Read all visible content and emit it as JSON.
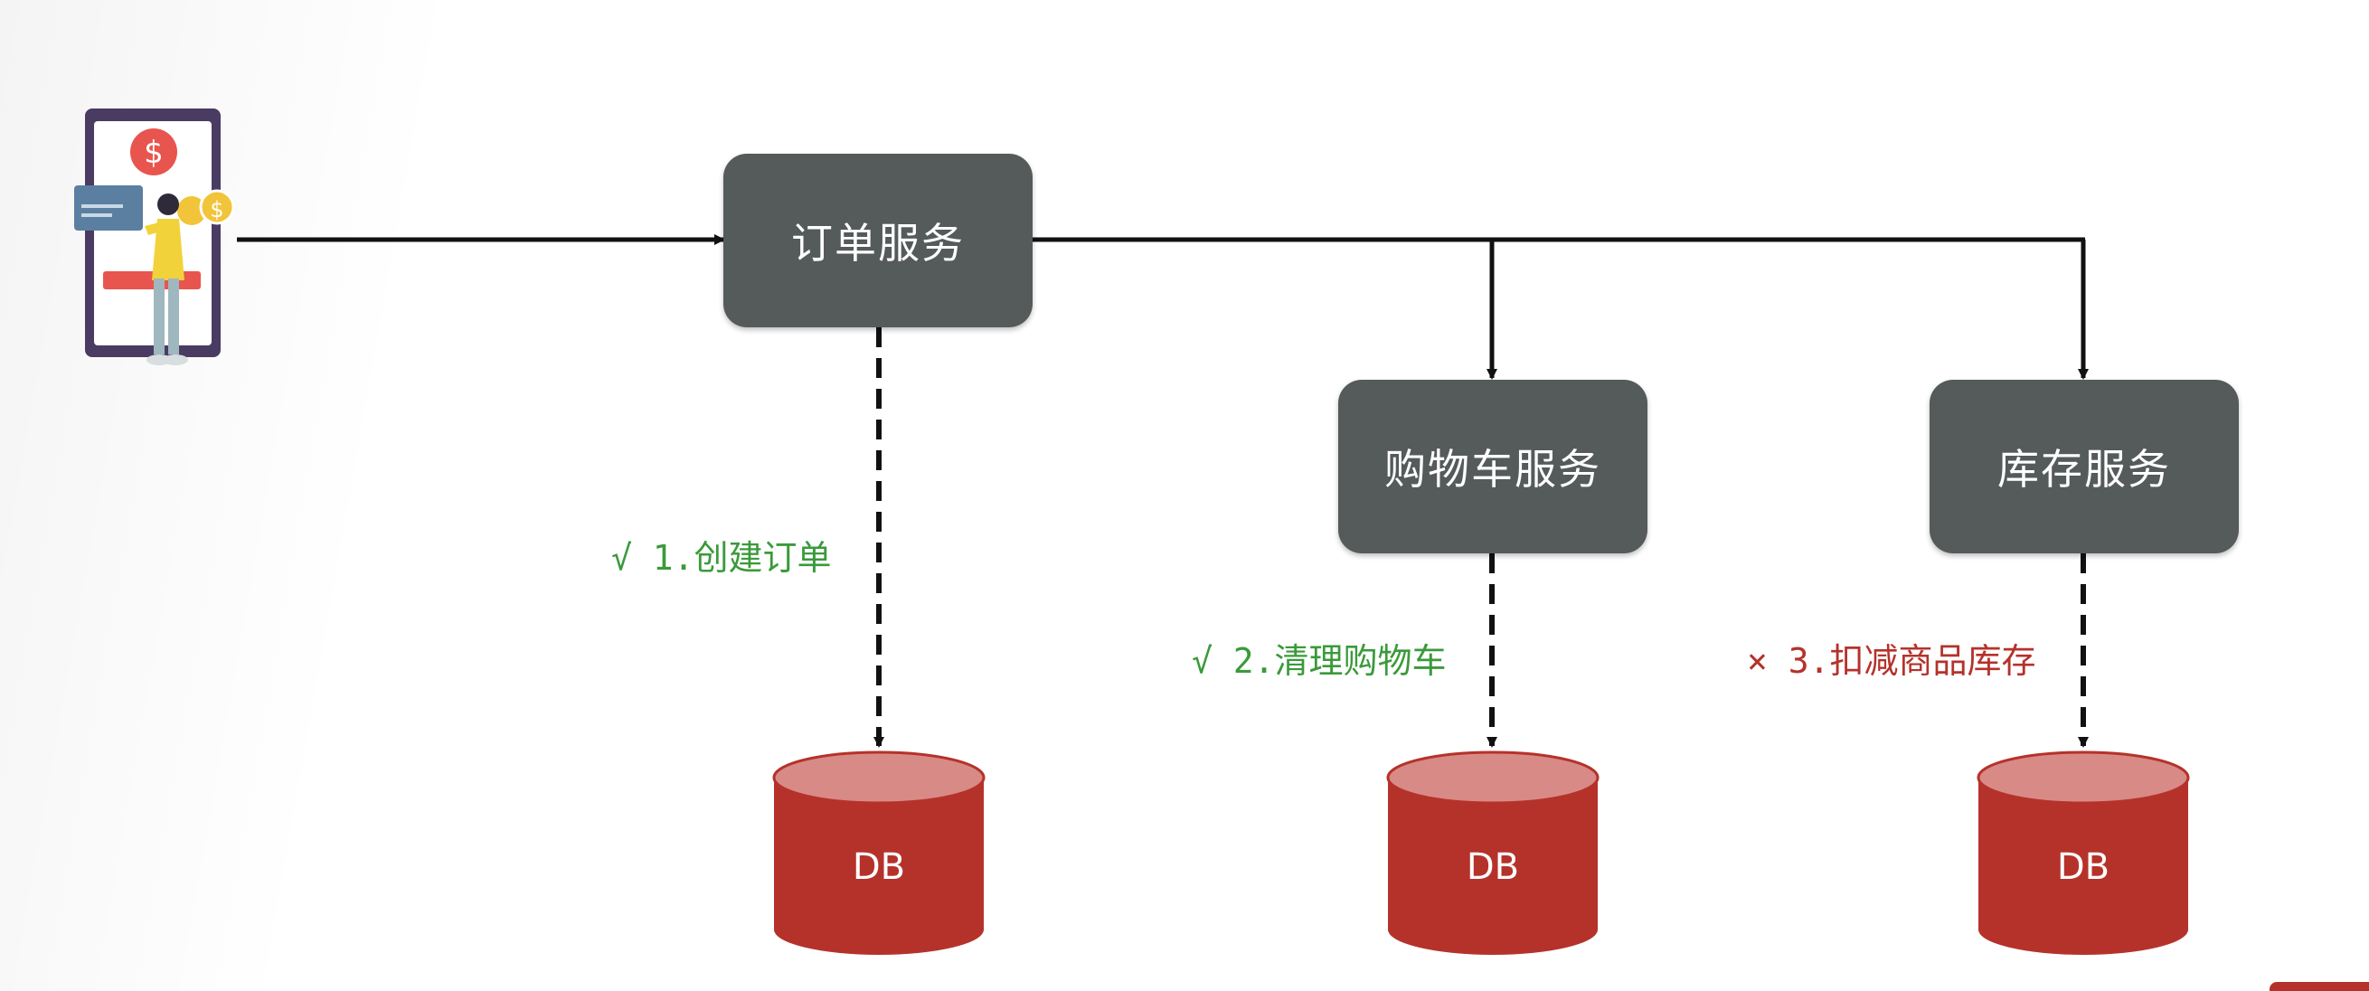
{
  "nodes": {
    "order": {
      "label": "订单服务"
    },
    "cart": {
      "label": "购物车服务"
    },
    "inventory": {
      "label": "库存服务"
    }
  },
  "steps": [
    {
      "mark": "√",
      "text": "1.创建订单",
      "status": "success",
      "color": "#3a9a3a"
    },
    {
      "mark": "√",
      "text": "2.清理购物车",
      "status": "success",
      "color": "#3a9a3a"
    },
    {
      "mark": "×",
      "text": "3.扣减商品库存",
      "status": "failure",
      "color": "#b5322b"
    }
  ],
  "databases": [
    {
      "label": "DB"
    },
    {
      "label": "DB"
    },
    {
      "label": "DB"
    }
  ],
  "colors": {
    "service_box": "#555a5a",
    "db_body": "#b5322b",
    "db_top": "#d88a86",
    "success": "#3a9a3a",
    "failure": "#b5322b"
  },
  "icons": {
    "client": "mobile-payment-user-icon"
  }
}
